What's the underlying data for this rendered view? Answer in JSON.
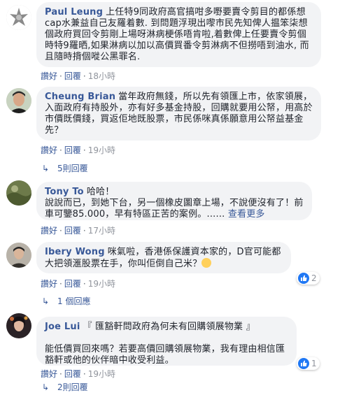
{
  "comments": [
    {
      "author": "Paul Leung",
      "text": "上任特9同政府高官搞咁多嘢要賣令剪目的都係想cap水兼益自己友羅着數. 到問題浮現出嚟市民先知俾人揾笨柒想個政府買回令剪剛上場呀淋病梗係唔肯啦,着數俾上任要賣令剪個時特9羅晒,如果淋病以加以高價買番令剪淋病不但撈唔到油水, 而且隨時揹個嘥公黑罪名.",
      "actions": {
        "like": "讚好",
        "reply": "回覆",
        "time": "18小時"
      }
    },
    {
      "author": "Cheung Brian",
      "text": "當年政府無錢，所以先有領匯上市，依家領展，入面政府有持股外，亦有好多基金持股，回購就要用公帑，用高於市價既價錢，買返佢地既股票，市民係咪真係願意用公帑益基金先？",
      "actions": {
        "like": "讚好",
        "reply": "回覆",
        "time": "19小時"
      },
      "replies": "5則回覆"
    },
    {
      "author": "Tony To",
      "text": "哈哈！\n說說而已，到她下台，另一個橡皮圖章上場，不說便沒有了！前車可鑒85.000，早有特區正苦的案例。...... ",
      "see_more": "查看更多",
      "actions": {
        "like": "讚好",
        "reply": "回覆",
        "time": "17小時"
      }
    },
    {
      "author": "Ibery Wong",
      "text": "咪氣啦，香港係保護資本家的，D官可能都大把領滙股票在手，你叫佢倒自己米？",
      "actions": {
        "like": "讚好",
        "reply": "回覆",
        "time": "19小時"
      },
      "reactions": "2",
      "replies": "1 個回應"
    },
    {
      "author": "Joe Lui",
      "text": "『 匯豁軒問政府為何未有回購領展物業 』\n\n能低價買回來嗎？若要高價回購領展物業，我有理由相信匯豁軒或他的伙伴暗中收受利益。",
      "actions": {
        "like": "讚好",
        "reply": "回覆",
        "time": "19小時"
      },
      "reactions": "1",
      "replies": "2則回覆"
    }
  ],
  "colors": {
    "link": "#385898",
    "bubble": "#f2f3f5",
    "like_blue": "#2078f4"
  }
}
